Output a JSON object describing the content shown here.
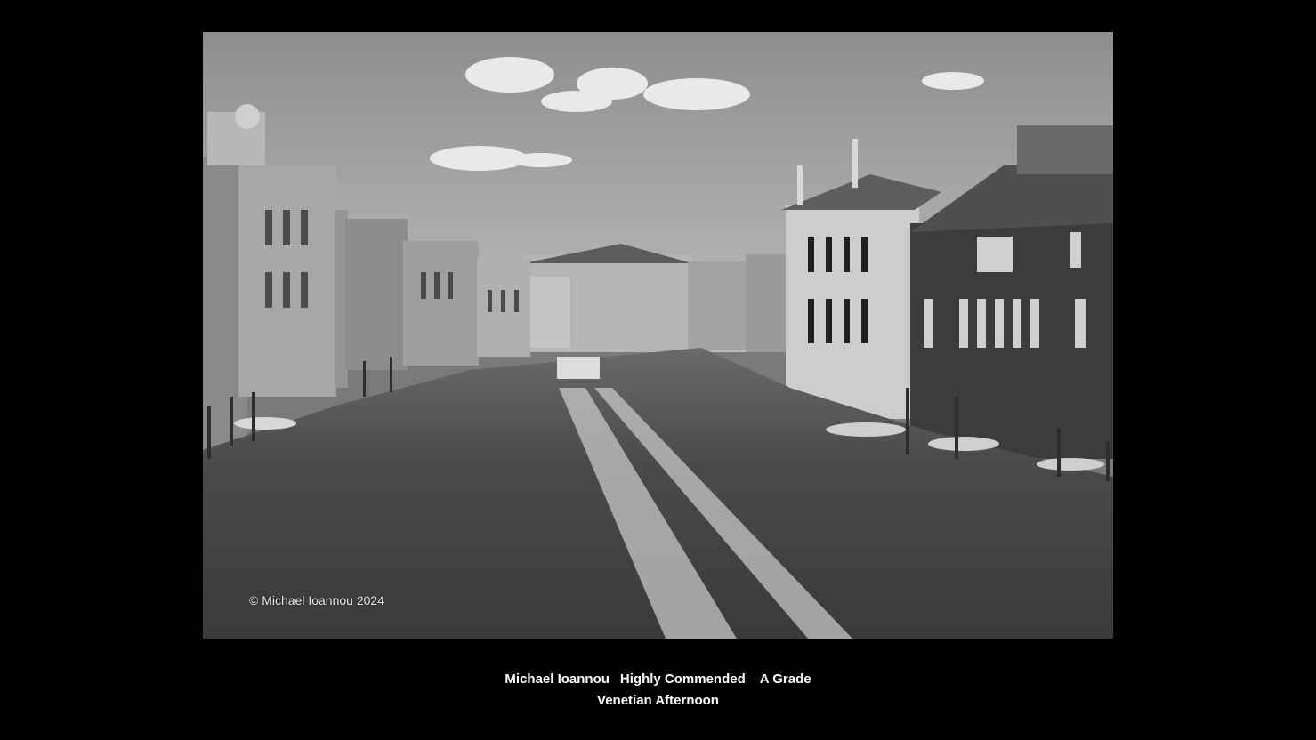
{
  "photo": {
    "subject": "Grand Canal, Venice (black and white)",
    "watermark": "© Michael Ioannou 2024"
  },
  "caption": {
    "author": "Michael Ioannou",
    "award": "Highly Commended",
    "grade": "A Grade",
    "title": "Venetian Afternoon"
  },
  "colors": {
    "background": "#000000",
    "caption_text": "#ffffff"
  }
}
